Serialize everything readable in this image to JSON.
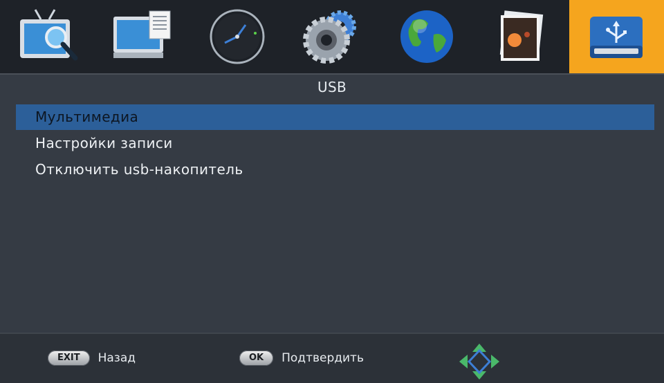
{
  "tabs": [
    {
      "name": "tv-search",
      "icon": "tv-search-icon",
      "active": false
    },
    {
      "name": "picture",
      "icon": "monitor-document-icon",
      "active": false
    },
    {
      "name": "time",
      "icon": "clock-icon",
      "active": false
    },
    {
      "name": "settings",
      "icon": "gears-icon",
      "active": false
    },
    {
      "name": "network",
      "icon": "globe-icon",
      "active": false
    },
    {
      "name": "photos",
      "icon": "photo-icon",
      "active": false
    },
    {
      "name": "usb",
      "icon": "usb-drive-icon",
      "active": true
    }
  ],
  "section": {
    "title": "USB"
  },
  "menu": {
    "items": [
      {
        "label": "Мультимедиа",
        "selected": true
      },
      {
        "label": "Настройки записи",
        "selected": false
      },
      {
        "label": "Отключить usb-накопитель",
        "selected": false
      }
    ]
  },
  "footer": {
    "exit": {
      "key": "EXIT",
      "label": "Назад"
    },
    "ok": {
      "key": "OK",
      "label": "Подтвердить"
    },
    "nav_icon": "navigation-arrows-icon"
  },
  "colors": {
    "active_tab": "#f5a51e",
    "selection": "#2c5f99",
    "background": "#353b44"
  }
}
